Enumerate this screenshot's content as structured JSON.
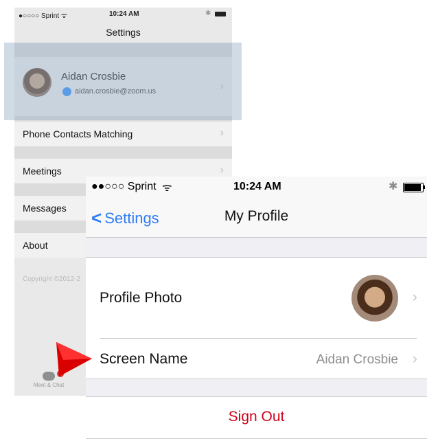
{
  "background_screen": {
    "status": {
      "carrier": "●○○○○ Sprint ᯤ",
      "time": "10:24 AM"
    },
    "title": "Settings",
    "profile": {
      "name": "Aidan Crosbie",
      "email": "aidan.crosbie@zoom.us"
    },
    "rows": [
      "Phone Contacts Matching",
      "Meetings",
      "Messages",
      "About"
    ],
    "copyright": "Copyright ©2012-2",
    "tab_label": "Meet & Chat"
  },
  "status_bar": {
    "carrier": "●●○○○ Sprint",
    "time": "10:24 AM"
  },
  "nav": {
    "back_label": "Settings",
    "title": "My Profile"
  },
  "profile_rows": {
    "photo_label": "Profile Photo",
    "screen_name_label": "Screen Name",
    "screen_name_value": "Aidan Crosbie"
  },
  "sign_out_label": "Sign Out",
  "colors": {
    "accent": "#2e7cf6",
    "destructive": "#d0021b",
    "pointer": "#d90000"
  }
}
